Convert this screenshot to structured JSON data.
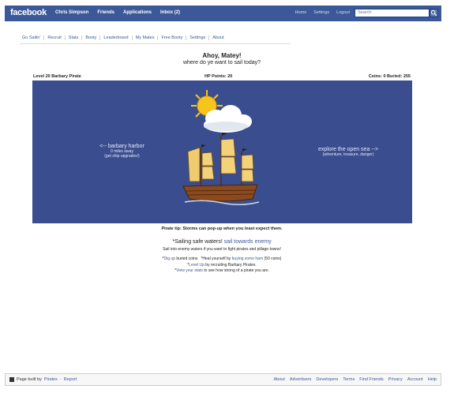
{
  "topbar": {
    "logo": "facebook",
    "nav_left": [
      "Chris Simpson",
      "Friends",
      "Applications",
      "Inbox (2)"
    ],
    "nav_right": [
      "Home",
      "Settings",
      "Logout"
    ],
    "search_placeholder": "Search"
  },
  "app_tabs": [
    "Go Sailin'",
    "Recruit",
    "Stats",
    "Booty",
    "Leaderboard",
    "My Mates",
    "Free Booty",
    "Settings",
    "About"
  ],
  "greeting": {
    "title": "Ahoy, Matey!",
    "subtitle": "where do ye want to sail today?"
  },
  "stats": {
    "level": "Level 20 Barbary Pirate",
    "hp": "HP Points: 20",
    "coins": "Coins: 0 Buried: 255"
  },
  "scene": {
    "left_title": "<-- barbary harbor",
    "left_line1": "0 miles away",
    "left_line2": "(get ship upgrades!)",
    "right_title": "explore the open sea -->",
    "right_line1": "(adventure, treasure, danger)",
    "colors": {
      "background": "#3a4d8f",
      "sun": "#f6c51b",
      "hull": "#8a4a1e",
      "sail": "#f3d27a"
    }
  },
  "tip": "Pirate tip: Storms can pop-up when you least expect them.",
  "sail": {
    "prefix": "*Sailing safe waters! ",
    "link": "sail towards enemy",
    "sub": "Sail into enemy waters if you want to fight pirates and pillage towns!"
  },
  "tips": {
    "t1_link": "Dig up",
    "t1_text": " buried coins",
    "t2_prefix": "*Heal yourself by ",
    "t2_link": "buying some ham",
    "t2_suffix": " (50 coins)",
    "t3_link": "Level Up",
    "t3_text": " by recruiting Barbary Pirates.",
    "t4_link": "View your stats",
    "t4_text": " to see how strong of a pirate you are."
  },
  "footer": {
    "built_by": "Page built by",
    "app": "Pirates",
    "report": "Report",
    "links": [
      "About",
      "Advertisers",
      "Developers",
      "Terms",
      "Find Friends",
      "Privacy",
      "Account",
      "Help"
    ]
  }
}
